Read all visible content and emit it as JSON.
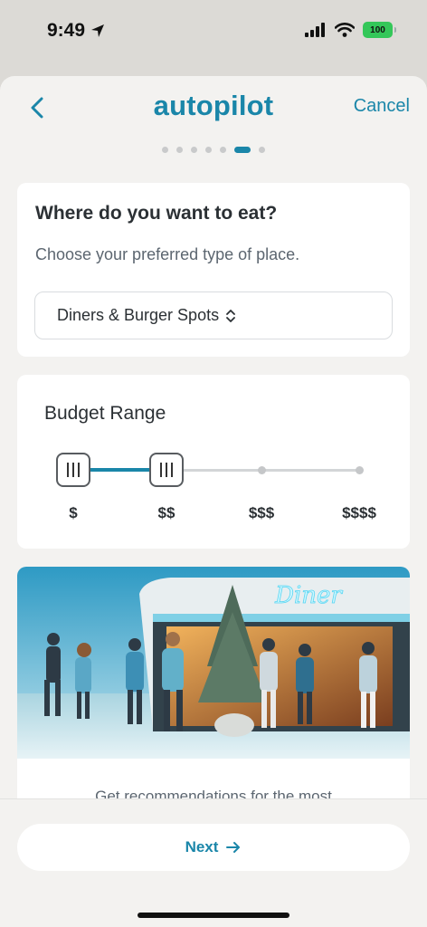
{
  "status": {
    "time": "9:49",
    "battery": "100"
  },
  "header": {
    "logo": "autopilot",
    "cancel": "Cancel"
  },
  "progress": {
    "steps": 7,
    "current": 6
  },
  "place": {
    "title": "Where do you want to eat?",
    "subtitle": "Choose your preferred type of place.",
    "selected": "Diners & Burger Spots"
  },
  "budget": {
    "title": "Budget Range",
    "labels": [
      "$",
      "$$",
      "$$$",
      "$$$$"
    ],
    "range_min_index": 0,
    "range_max_index": 1
  },
  "image": {
    "sign_text": "Diner",
    "caption": "Get recommendations for the most"
  },
  "footer": {
    "next": "Next"
  },
  "colors": {
    "accent": "#1a86a9",
    "battery": "#34c759"
  }
}
